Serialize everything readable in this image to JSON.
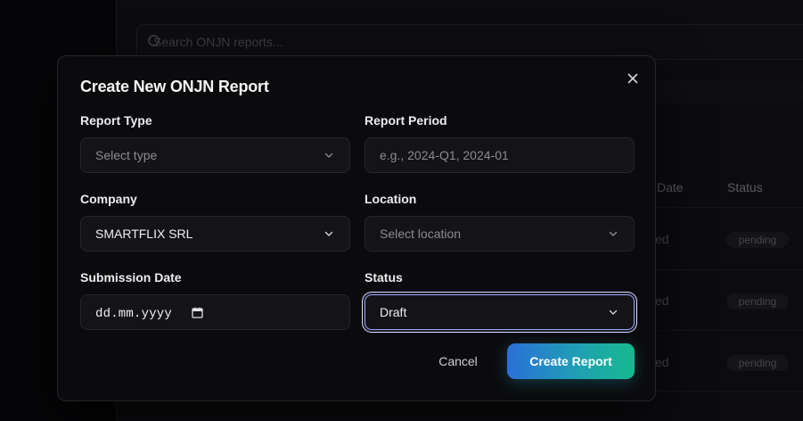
{
  "background": {
    "search_placeholder": "Search ONJN reports...",
    "table_headers": [
      "Date",
      "Status"
    ],
    "rows": [
      {
        "date_fragment": "ed",
        "status": "pending"
      },
      {
        "date_fragment": "ed",
        "status": "pending"
      },
      {
        "date_fragment": "ed",
        "status": "pending"
      }
    ]
  },
  "modal": {
    "title": "Create New ONJN Report",
    "fields": {
      "report_type": {
        "label": "Report Type",
        "placeholder": "Select type"
      },
      "report_period": {
        "label": "Report Period",
        "placeholder": "e.g., 2024-Q1, 2024-01"
      },
      "company": {
        "label": "Company",
        "value": "SMARTFLIX SRL"
      },
      "location": {
        "label": "Location",
        "placeholder": "Select location"
      },
      "submission_date": {
        "label": "Submission Date",
        "value": "dd.mm.yyyy"
      },
      "status": {
        "label": "Status",
        "value": "Draft"
      }
    },
    "buttons": {
      "cancel": "Cancel",
      "create": "Create Report"
    }
  },
  "colors": {
    "accent_start": "#2a6fd8",
    "accent_end": "#16b98e",
    "focus_ring": "#d7dcff"
  }
}
